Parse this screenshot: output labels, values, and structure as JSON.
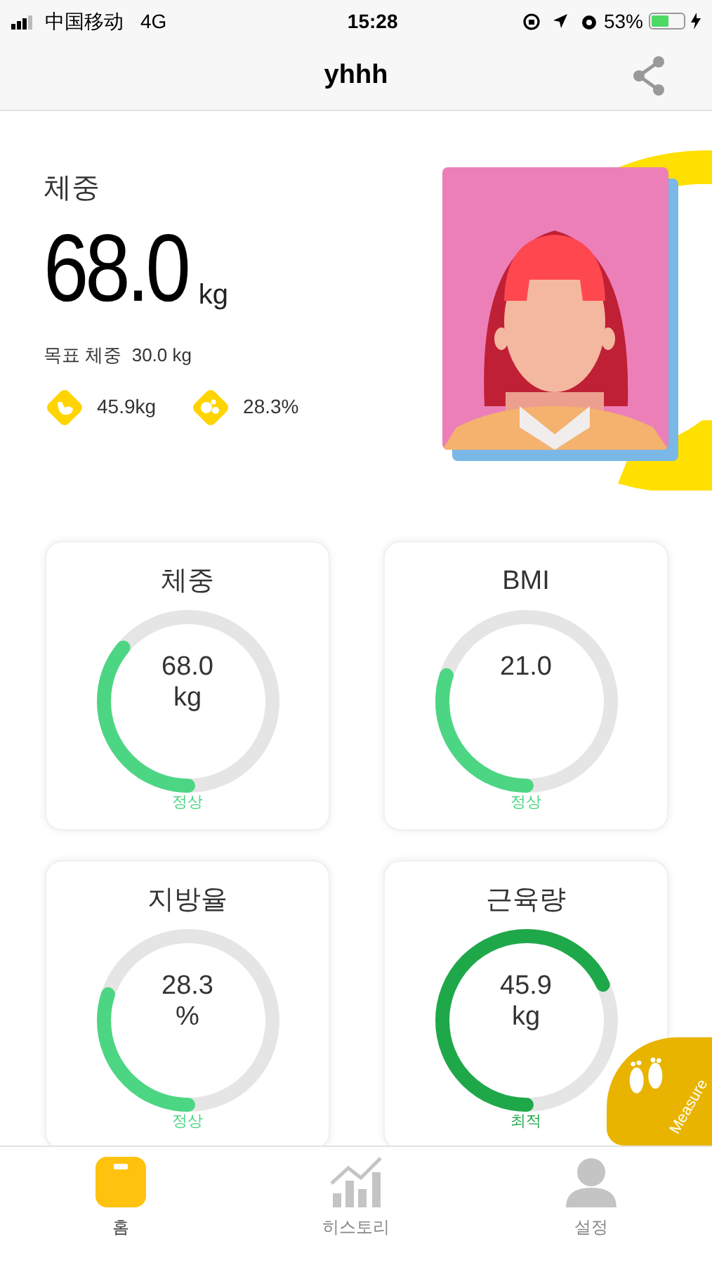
{
  "status_bar": {
    "carrier": "中国移动",
    "network": "4G",
    "time": "15:28",
    "battery_text": "53%"
  },
  "nav": {
    "title": "yhhh"
  },
  "summary": {
    "label": "체중",
    "value": "68.0",
    "unit": "kg",
    "goal": "목표 체중  30.0 kg",
    "stats": [
      {
        "kind": "muscle",
        "text": "45.9kg"
      },
      {
        "kind": "fat",
        "text": "28.3%"
      }
    ]
  },
  "cards": [
    {
      "title": "체중",
      "value": "68.0",
      "unit": "kg",
      "level": 0.36,
      "status": "정상",
      "color": "#4cd683"
    },
    {
      "title": "BMI",
      "value": "21.0",
      "level": 0.3,
      "status": "정상",
      "color": "#4cd683"
    },
    {
      "title": "지방율",
      "value": "28.3",
      "unit": "%",
      "level": 0.3,
      "status": "정상",
      "color": "#4cd683"
    },
    {
      "title": "근육량",
      "value": "45.9",
      "unit": "kg",
      "level": 0.68,
      "status": "최적",
      "color": "#1fa84a"
    }
  ],
  "measure_button": {
    "label": "Measure"
  },
  "tabs": [
    {
      "kind": "home",
      "label": "홈",
      "selected": true
    },
    {
      "kind": "history",
      "label": "히스토리",
      "selected": false
    },
    {
      "kind": "settings",
      "label": "설정",
      "selected": false
    }
  ]
}
